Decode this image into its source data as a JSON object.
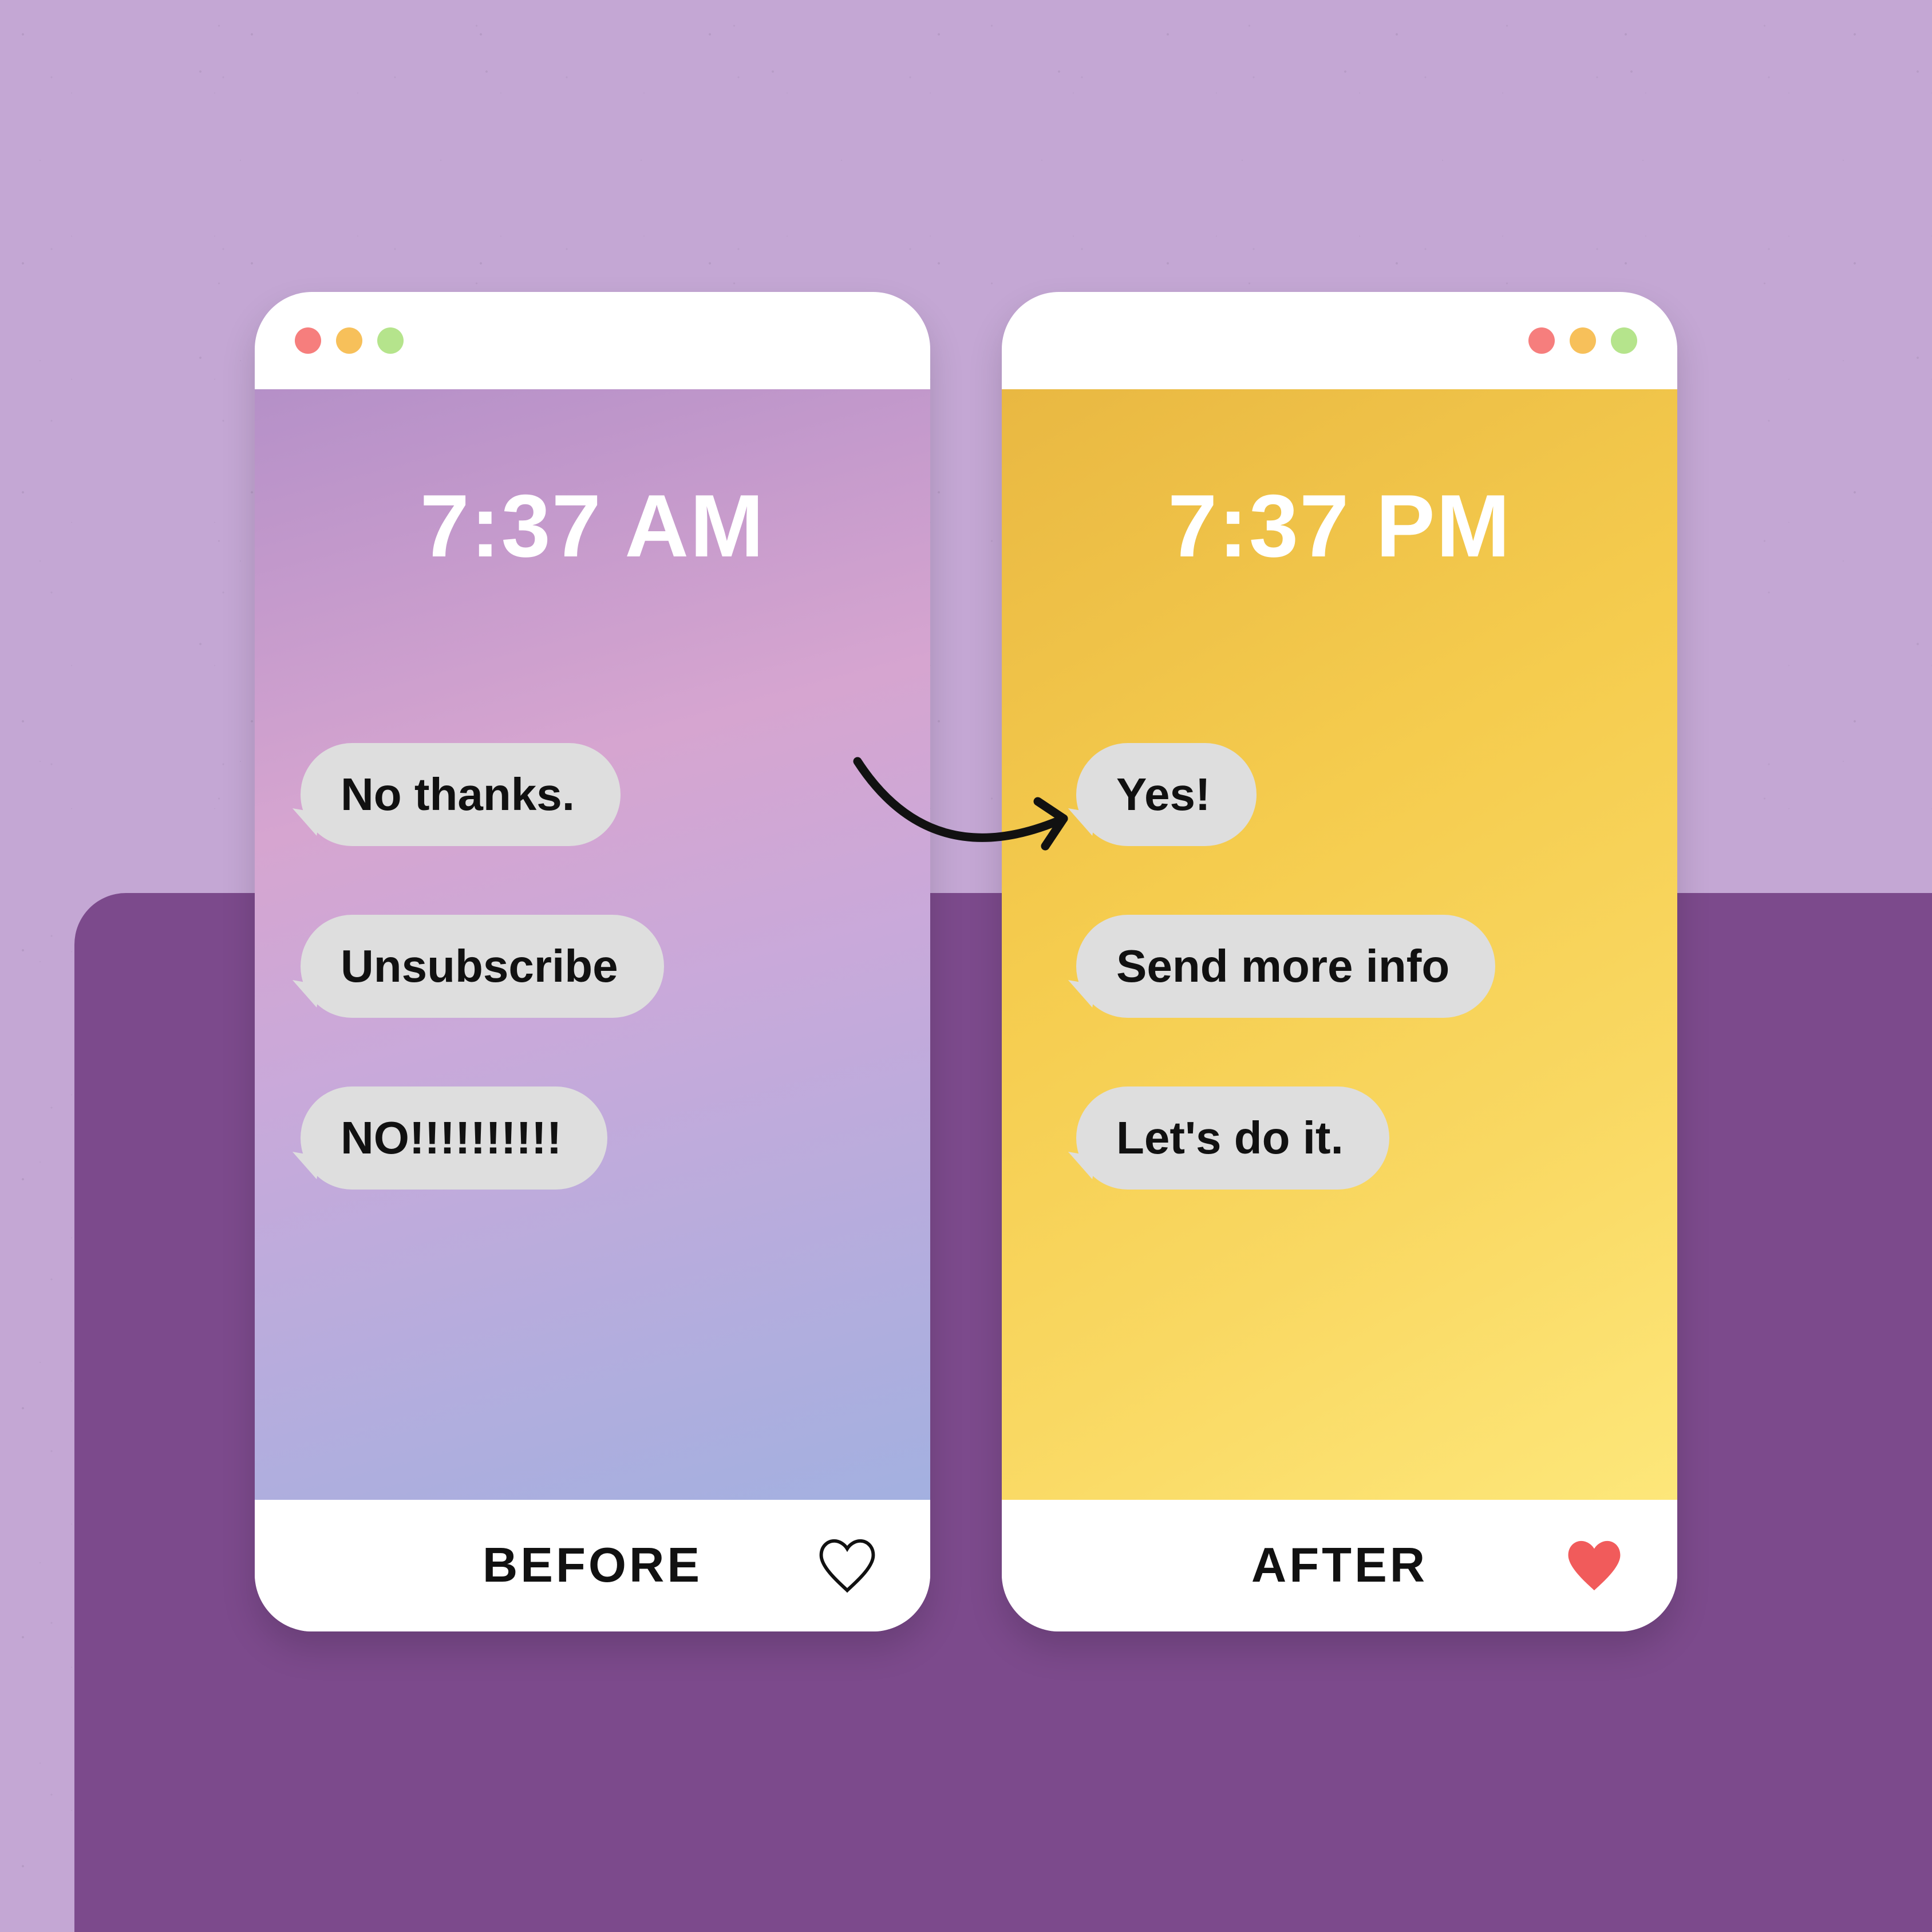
{
  "before": {
    "time": "7:37 AM",
    "messages": [
      "No thanks.",
      "Unsubscribe",
      "NO!!!!!!!!!!"
    ],
    "footer_label": "BEFORE",
    "heart_filled": false
  },
  "after": {
    "time": "7:37 PM",
    "messages": [
      "Yes!",
      "Send more info",
      "Let's do it."
    ],
    "footer_label": "AFTER",
    "heart_filled": true
  },
  "colors": {
    "bg_light": "#c4a7d4",
    "bg_dark": "#7c4a8c",
    "dot_red": "#f67e7d",
    "dot_yellow": "#f7c05a",
    "dot_green": "#b5e48c",
    "bubble": "#dedede",
    "heart_fill": "#f15b5b"
  }
}
